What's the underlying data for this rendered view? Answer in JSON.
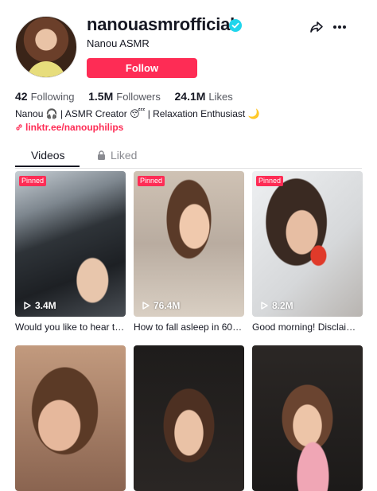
{
  "profile": {
    "username": "nanouasmrofficial",
    "nickname": "Nanou ASMR",
    "follow_label": "Follow",
    "verified_icon": "verified-badge-icon",
    "accent_color": "#fe2c55"
  },
  "stats": {
    "following_count": "42",
    "following_label": "Following",
    "followers_count": "1.5M",
    "followers_label": "Followers",
    "likes_count": "24.1M",
    "likes_label": "Likes"
  },
  "bio": {
    "text": "Nanou 🎧 | ASMR Creator 😴 | Relaxation Enthusiast 🌙",
    "link": "linktr.ee/nanouphilips"
  },
  "tabs": {
    "videos_label": "Videos",
    "liked_label": "Liked"
  },
  "videos": [
    {
      "pinned": "Pinned",
      "views": "3.4M",
      "caption": "Would you like to hear th..."
    },
    {
      "pinned": "Pinned",
      "views": "76.4M",
      "caption": "How to fall asleep in 60 s..."
    },
    {
      "pinned": "Pinned",
      "views": "8.2M",
      "caption": "Good morning! Disclaime..."
    },
    {
      "pinned": "",
      "views": "",
      "caption": ""
    },
    {
      "pinned": "",
      "views": "",
      "caption": ""
    },
    {
      "pinned": "",
      "views": "",
      "caption": ""
    }
  ]
}
